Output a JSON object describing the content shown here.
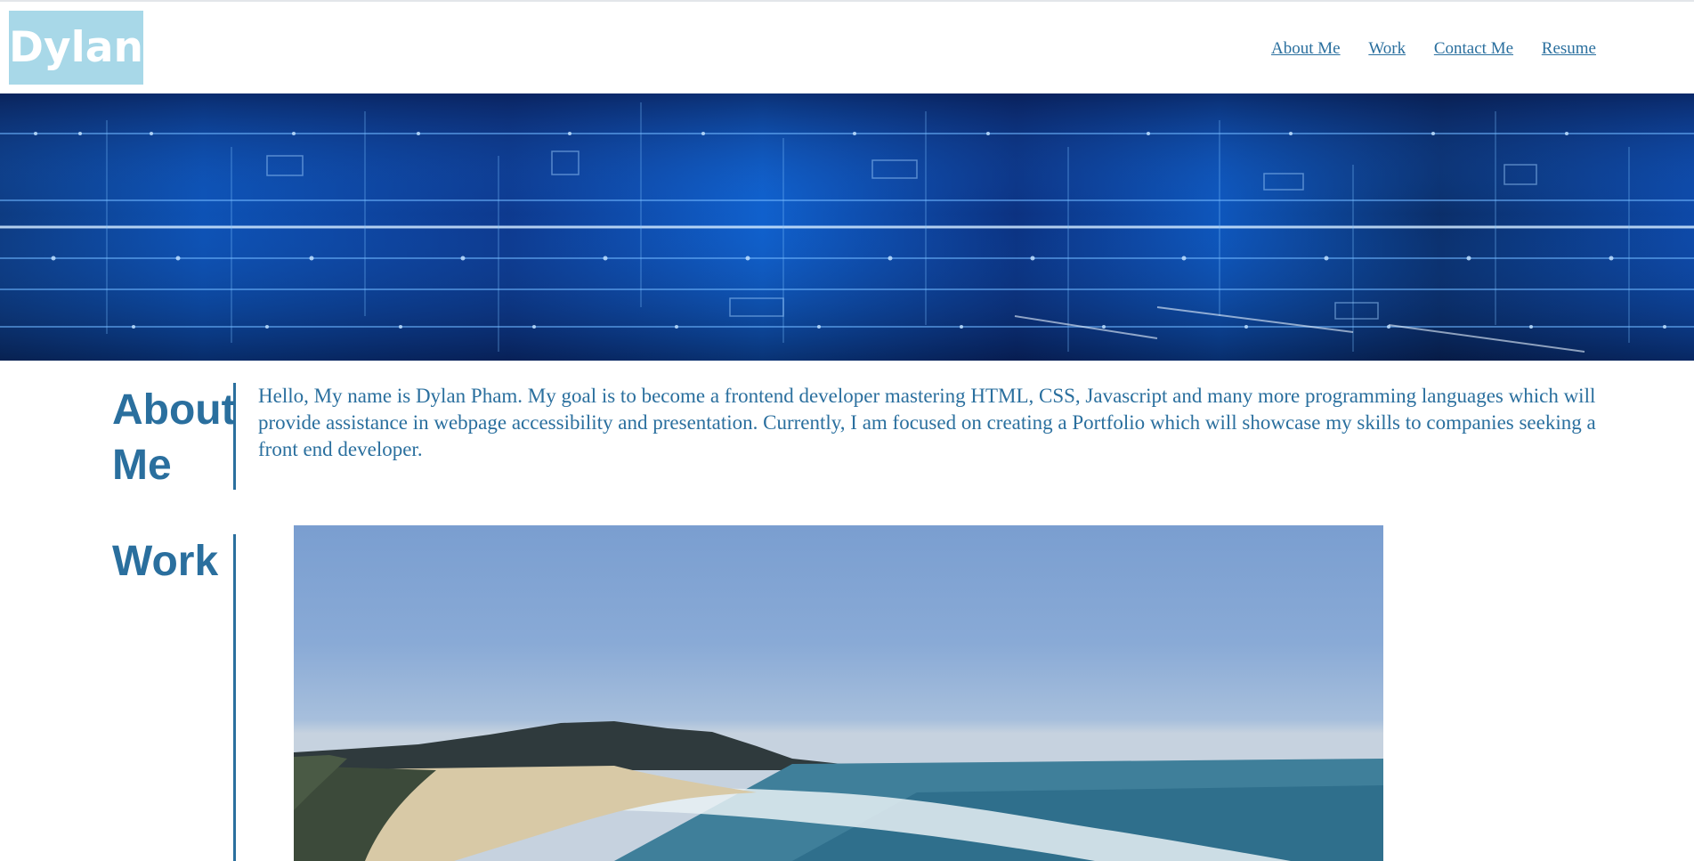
{
  "header": {
    "logo_text": "Dylan",
    "nav": [
      {
        "label": "About Me"
      },
      {
        "label": "Work"
      },
      {
        "label": "Contact Me"
      },
      {
        "label": "Resume"
      }
    ]
  },
  "banner": {
    "icon": "circuit-board-banner"
  },
  "about": {
    "title_line1": "About",
    "title_line2": "Me",
    "text": "Hello, My name is Dylan Pham. My goal is to become a frontend developer mastering HTML, CSS, Javascript and many more programming languages which will provide assistance in webpage accessibility and presentation. Currently, I am focused on creating a Portfolio which will showcase my skills to companies seeking a front end developer."
  },
  "work": {
    "title": "Work",
    "image": "beach-landscape-image"
  },
  "colors": {
    "accent": "#2a6f9e",
    "logo_bg": "#a8d8e8",
    "logo_text": "#ffffff"
  }
}
